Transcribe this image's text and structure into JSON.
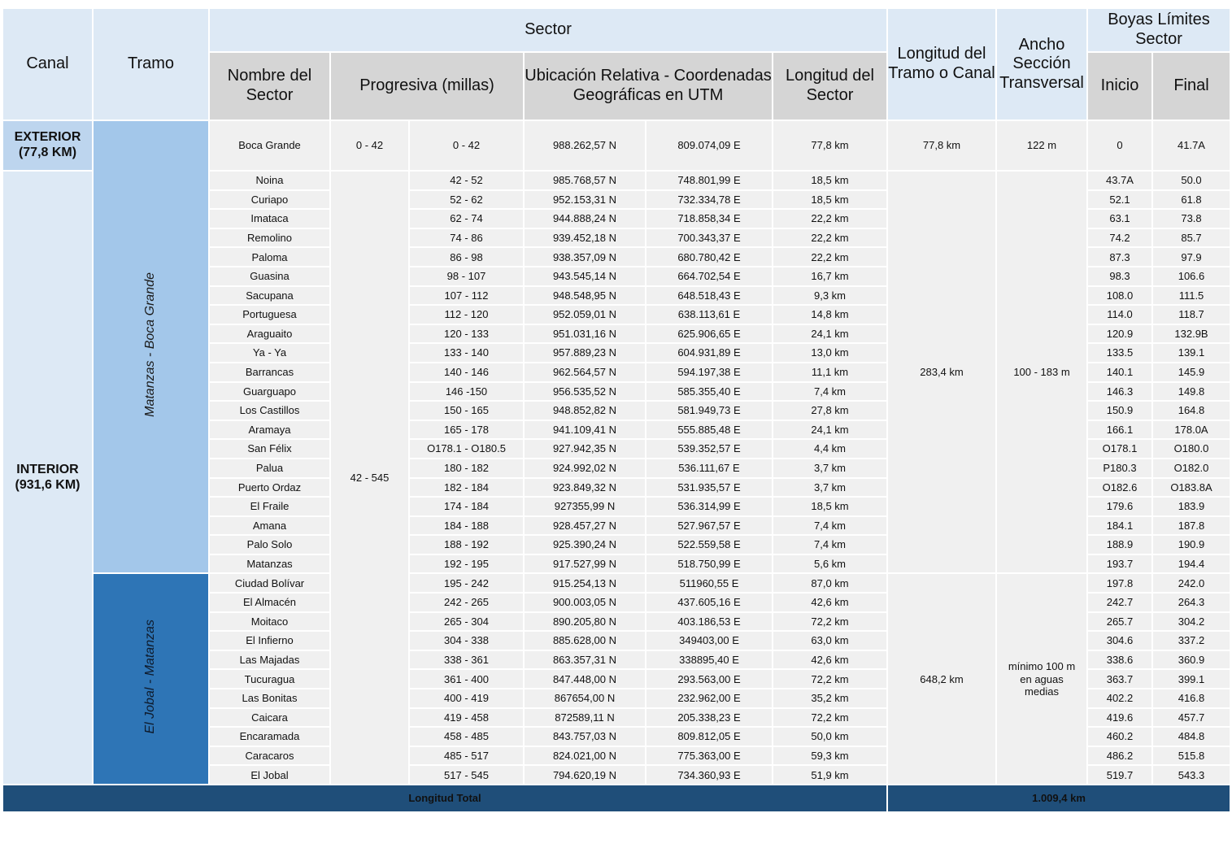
{
  "header": {
    "canal": "Canal",
    "tramo": "Tramo",
    "sector": "Sector",
    "nombre_sector": "Nombre del Sector",
    "progresiva": "Progresiva (millas)",
    "ubicacion": "Ubicación Relativa - Coordenadas Geográficas en UTM",
    "longitud_sector": "Longitud del Sector",
    "longitud_tramo": "Longitud del Tramo o Canal",
    "ancho": "Ancho Sección Transversal",
    "boyas": "Boyas Límites Sector",
    "inicio": "Inicio",
    "final": "Final"
  },
  "canales": {
    "exterior": "EXTERIOR (77,8 KM)",
    "interior": "INTERIOR (931,6 KM)"
  },
  "tramos": {
    "matanzas_boca_grande": "Matanzas - Boca Grande",
    "el_jobal_matanzas": "El Jobal - Matanzas"
  },
  "merged": {
    "progresiva_exterior": "0 - 42",
    "progresiva_interior": "42 - 545",
    "longitud_tramo_exterior": "77,8 km",
    "longitud_tramo_matanzas": "283,4 km",
    "longitud_tramo_jobal": "648,2 km",
    "ancho_exterior": "122 m",
    "ancho_matanzas": "100 - 183 m",
    "ancho_jobal": "mínimo 100 m en aguas medias"
  },
  "rows": [
    {
      "nombre": "Boca Grande",
      "prog": "0 - 42",
      "norte": "988.262,57 N",
      "este": "809.074,09 E",
      "long": "77,8 km",
      "inicio": "0",
      "final": "41.7A"
    },
    {
      "nombre": "Noina",
      "prog": "42 - 52",
      "norte": "985.768,57 N",
      "este": "748.801,99 E",
      "long": "18,5 km",
      "inicio": "43.7A",
      "final": "50.0"
    },
    {
      "nombre": "Curiapo",
      "prog": "52 - 62",
      "norte": "952.153,31 N",
      "este": "732.334,78 E",
      "long": "18,5 km",
      "inicio": "52.1",
      "final": "61.8"
    },
    {
      "nombre": "Imataca",
      "prog": "62 - 74",
      "norte": "944.888,24 N",
      "este": "718.858,34 E",
      "long": "22,2 km",
      "inicio": "63.1",
      "final": "73.8"
    },
    {
      "nombre": "Remolino",
      "prog": "74 - 86",
      "norte": "939.452,18 N",
      "este": "700.343,37 E",
      "long": "22,2 km",
      "inicio": "74.2",
      "final": "85.7"
    },
    {
      "nombre": "Paloma",
      "prog": "86 - 98",
      "norte": "938.357,09 N",
      "este": "680.780,42 E",
      "long": "22,2 km",
      "inicio": "87.3",
      "final": "97.9"
    },
    {
      "nombre": "Guasina",
      "prog": "98 - 107",
      "norte": "943.545,14 N",
      "este": "664.702,54 E",
      "long": "16,7 km",
      "inicio": "98.3",
      "final": "106.6"
    },
    {
      "nombre": "Sacupana",
      "prog": "107 - 112",
      "norte": "948.548,95 N",
      "este": "648.518,43 E",
      "long": "9,3 km",
      "inicio": "108.0",
      "final": "111.5"
    },
    {
      "nombre": "Portuguesa",
      "prog": "112 - 120",
      "norte": "952.059,01 N",
      "este": "638.113,61 E",
      "long": "14,8 km",
      "inicio": "114.0",
      "final": "118.7"
    },
    {
      "nombre": "Araguaito",
      "prog": "120 - 133",
      "norte": "951.031,16 N",
      "este": "625.906,65 E",
      "long": "24,1 km",
      "inicio": "120.9",
      "final": "132.9B"
    },
    {
      "nombre": "Ya - Ya",
      "prog": "133 - 140",
      "norte": "957.889,23 N",
      "este": "604.931,89 E",
      "long": "13,0 km",
      "inicio": "133.5",
      "final": "139.1"
    },
    {
      "nombre": "Barrancas",
      "prog": "140 - 146",
      "norte": "962.564,57 N",
      "este": "594.197,38 E",
      "long": "11,1 km",
      "inicio": "140.1",
      "final": "145.9"
    },
    {
      "nombre": "Guarguapo",
      "prog": "146 -150",
      "norte": "956.535,52 N",
      "este": "585.355,40 E",
      "long": "7,4 km",
      "inicio": "146.3",
      "final": "149.8"
    },
    {
      "nombre": "Los Castillos",
      "prog": "150 - 165",
      "norte": "948.852,82 N",
      "este": "581.949,73 E",
      "long": "27,8 km",
      "inicio": "150.9",
      "final": "164.8"
    },
    {
      "nombre": "Aramaya",
      "prog": "165 - 178",
      "norte": "941.109,41 N",
      "este": "555.885,48 E",
      "long": "24,1 km",
      "inicio": "166.1",
      "final": "178.0A"
    },
    {
      "nombre": "San Félix",
      "prog": "O178.1 - O180.5",
      "norte": "927.942,35 N",
      "este": "539.352,57 E",
      "long": "4,4 km",
      "inicio": "O178.1",
      "final": "O180.0"
    },
    {
      "nombre": "Palua",
      "prog": "180 - 182",
      "norte": "924.992,02 N",
      "este": "536.111,67 E",
      "long": "3,7 km",
      "inicio": "P180.3",
      "final": "O182.0"
    },
    {
      "nombre": "Puerto Ordaz",
      "prog": "182 - 184",
      "norte": "923.849,32 N",
      "este": "531.935,57 E",
      "long": "3,7 km",
      "inicio": "O182.6",
      "final": "O183.8A"
    },
    {
      "nombre": "El Fraile",
      "prog": "174 - 184",
      "norte": "927355,99 N",
      "este": "536.314,99 E",
      "long": "18,5 km",
      "inicio": "179.6",
      "final": "183.9"
    },
    {
      "nombre": "Amana",
      "prog": "184 - 188",
      "norte": "928.457,27 N",
      "este": "527.967,57 E",
      "long": "7,4 km",
      "inicio": "184.1",
      "final": "187.8"
    },
    {
      "nombre": "Palo Solo",
      "prog": "188 - 192",
      "norte": "925.390,24 N",
      "este": "522.559,58 E",
      "long": "7,4 km",
      "inicio": "188.9",
      "final": "190.9"
    },
    {
      "nombre": "Matanzas",
      "prog": "192 - 195",
      "norte": "917.527,99 N",
      "este": "518.750,99 E",
      "long": "5,6 km",
      "inicio": "193.7",
      "final": "194.4"
    },
    {
      "nombre": "Ciudad Bolívar",
      "prog": "195 - 242",
      "norte": "915.254,13 N",
      "este": "511960,55 E",
      "long": "87,0 km",
      "inicio": "197.8",
      "final": "242.0"
    },
    {
      "nombre": "El Almacén",
      "prog": "242 - 265",
      "norte": "900.003,05 N",
      "este": "437.605,16 E",
      "long": "42,6 km",
      "inicio": "242.7",
      "final": "264.3"
    },
    {
      "nombre": "Moitaco",
      "prog": "265 - 304",
      "norte": "890.205,80 N",
      "este": "403.186,53 E",
      "long": "72,2 km",
      "inicio": "265.7",
      "final": "304.2"
    },
    {
      "nombre": "El Infierno",
      "prog": "304 - 338",
      "norte": "885.628,00 N",
      "este": "349403,00 E",
      "long": "63,0 km",
      "inicio": "304.6",
      "final": "337.2"
    },
    {
      "nombre": "Las Majadas",
      "prog": "338 - 361",
      "norte": "863.357,31 N",
      "este": "338895,40 E",
      "long": "42,6 km",
      "inicio": "338.6",
      "final": "360.9"
    },
    {
      "nombre": "Tucuragua",
      "prog": "361 - 400",
      "norte": "847.448,00 N",
      "este": "293.563,00 E",
      "long": "72,2 km",
      "inicio": "363.7",
      "final": "399.1"
    },
    {
      "nombre": "Las Bonitas",
      "prog": "400 - 419",
      "norte": "867654,00 N",
      "este": "232.962,00 E",
      "long": "35,2 km",
      "inicio": "402.2",
      "final": "416.8"
    },
    {
      "nombre": "Caicara",
      "prog": "419 - 458",
      "norte": "872589,11 N",
      "este": "205.338,23 E",
      "long": "72,2 km",
      "inicio": "419.6",
      "final": "457.7"
    },
    {
      "nombre": "Encaramada",
      "prog": "458 - 485",
      "norte": "843.757,03 N",
      "este": "809.812,05 E",
      "long": "50,0 km",
      "inicio": "460.2",
      "final": "484.8"
    },
    {
      "nombre": "Caracaros",
      "prog": "485 - 517",
      "norte": "824.021,00 N",
      "este": "775.363,00 E",
      "long": "59,3 km",
      "inicio": "486.2",
      "final": "515.8"
    },
    {
      "nombre": "El Jobal",
      "prog": "517 - 545",
      "norte": "794.620,19 N",
      "este": "734.360,93 E",
      "long": "51,9 km",
      "inicio": "519.7",
      "final": "543.3"
    }
  ],
  "footer": {
    "label": "Longitud Total",
    "value": "1.009,4 km"
  }
}
